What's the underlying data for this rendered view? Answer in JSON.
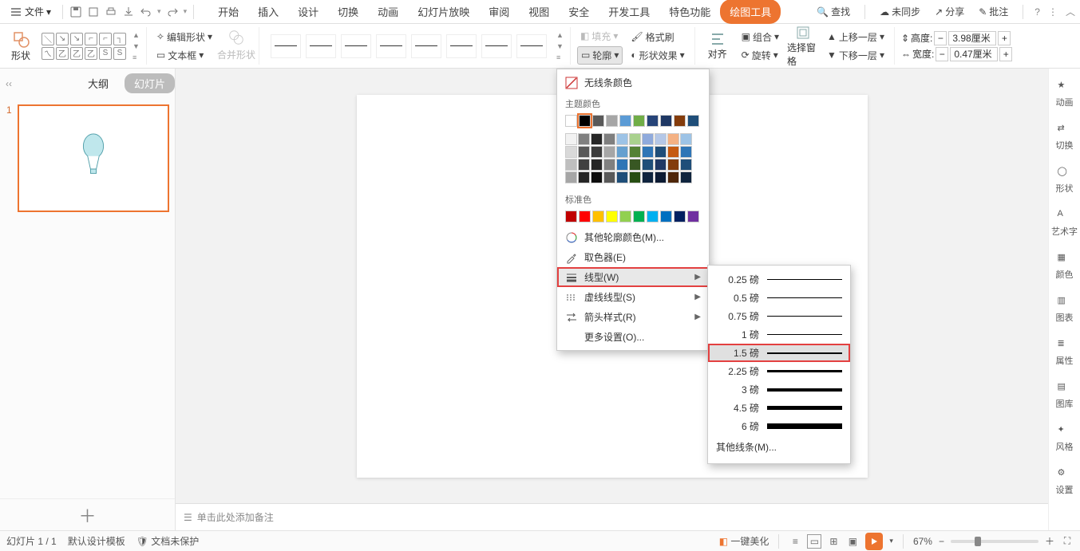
{
  "menu": {
    "file_label": "文件",
    "tabs": [
      "开始",
      "插入",
      "设计",
      "切换",
      "动画",
      "幻灯片放映",
      "审阅",
      "视图",
      "安全",
      "开发工具",
      "特色功能",
      "绘图工具"
    ],
    "active_tab_index": 11,
    "find": "查找",
    "unsync": "未同步",
    "share": "分享",
    "comments": "批注"
  },
  "ribbon": {
    "shape_label": "形状",
    "edit_shape": "编辑形状",
    "textbox": "文本框",
    "merge_shapes": "合并形状",
    "fill": "填充",
    "outline": "轮廓",
    "format_painter": "格式刷",
    "shape_effect": "形状效果",
    "align": "对齐",
    "group": "组合",
    "rotate": "旋转",
    "select_pane": "选择窗格",
    "bring_forward": "上移一层",
    "send_backward": "下移一层",
    "height_label": "高度:",
    "width_label": "宽度:",
    "height_value": "3.98厘米",
    "width_value": "0.47厘米"
  },
  "left_panel": {
    "outline_tab": "大纲",
    "slides_tab": "幻灯片",
    "slide_number": "1"
  },
  "outline_popup": {
    "no_line_color": "无线条颜色",
    "theme_colors": "主题颜色",
    "theme_grid": [
      [
        "#FFFFFF",
        "#000000",
        "#595959",
        "#A6A6A6",
        "#5B9BD5",
        "#70AD47",
        "#264478",
        "#1F3864",
        "#843C0C",
        "#1F4E79"
      ],
      [
        "#F2F2F2",
        "#808080",
        "#262626",
        "#7F7F7F",
        "#9DC3E6",
        "#A9D18E",
        "#8FAADC",
        "#B4C7E7",
        "#F4B183",
        "#9DC3E6"
      ],
      [
        "#D9D9D9",
        "#595959",
        "#3B3B3B",
        "#A6A6A6",
        "#66A0CF",
        "#548235",
        "#2E75B6",
        "#1F4E79",
        "#C55A11",
        "#2E75B6"
      ],
      [
        "#BFBFBF",
        "#404040",
        "#262626",
        "#808080",
        "#2E75B6",
        "#385723",
        "#1F4E79",
        "#203864",
        "#833C0C",
        "#1F4E79"
      ],
      [
        "#A6A6A6",
        "#262626",
        "#0D0D0D",
        "#595959",
        "#1F4E79",
        "#274E13",
        "#0F243E",
        "#0C1B33",
        "#4E260A",
        "#0F243E"
      ]
    ],
    "standard_colors": "标准色",
    "standard_grid": [
      "#C00000",
      "#FF0000",
      "#FFC000",
      "#FFFF00",
      "#92D050",
      "#00B050",
      "#00B0F0",
      "#0070C0",
      "#002060",
      "#7030A0"
    ],
    "more_colors": "其他轮廓颜色(M)...",
    "eyedropper": "取色器(E)",
    "line_weight": "线型(W)",
    "dash_style": "虚线线型(S)",
    "arrow_style": "箭头样式(R)",
    "more_settings": "更多设置(O)..."
  },
  "weight_flyout": {
    "weights": [
      {
        "label": "0.25 磅",
        "w": 0.5
      },
      {
        "label": "0.5 磅",
        "w": 1
      },
      {
        "label": "0.75 磅",
        "w": 1
      },
      {
        "label": "1 磅",
        "w": 1.5
      },
      {
        "label": "1.5 磅",
        "w": 2
      },
      {
        "label": "2.25 磅",
        "w": 3
      },
      {
        "label": "3 磅",
        "w": 4
      },
      {
        "label": "4.5 磅",
        "w": 5.5
      },
      {
        "label": "6 磅",
        "w": 7
      }
    ],
    "selected_index": 4,
    "other_lines": "其他线条(M)..."
  },
  "right_rail": [
    "动画",
    "切换",
    "形状",
    "艺术字",
    "颜色",
    "图表",
    "属性",
    "图库",
    "风格",
    "设置"
  ],
  "notes_placeholder": "单击此处添加备注",
  "status": {
    "slide_counter": "幻灯片 1 / 1",
    "template": "默认设计模板",
    "protect": "文档未保护",
    "beautify": "一键美化",
    "zoom": "67%"
  }
}
